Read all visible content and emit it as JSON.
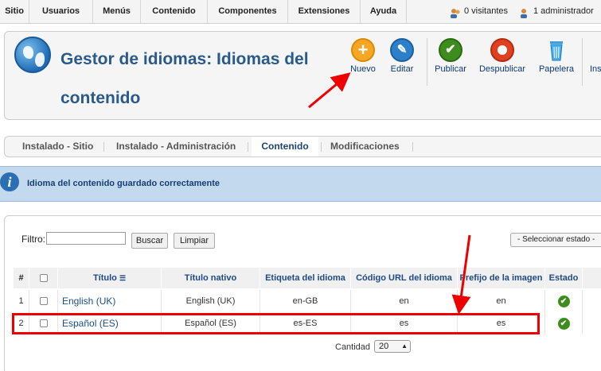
{
  "menu": {
    "items": [
      "Sitio",
      "Usuarios",
      "Menús",
      "Contenido",
      "Componentes",
      "Extensiones",
      "Ayuda"
    ],
    "visitors": "0 visitantes",
    "admins": "1 administrador"
  },
  "header": {
    "title_line1": "Gestor de idiomas: Idiomas del",
    "title_line2": "contenido"
  },
  "toolbar": {
    "new": "Nuevo",
    "edit": "Editar",
    "publish": "Publicar",
    "unpublish": "Despublicar",
    "trash": "Papelera",
    "partial": "Ins"
  },
  "tabs": [
    "Instalado - Sitio",
    "Instalado - Administración",
    "Contenido",
    "Modificaciones"
  ],
  "message": "Idioma del contenido guardado correctamente",
  "filter": {
    "label": "Filtro:",
    "value": "",
    "search": "Buscar",
    "clear": "Limpiar",
    "state": "- Seleccionar estado -"
  },
  "table": {
    "headers": [
      "#",
      "",
      "Título",
      "Título nativo",
      "Etiqueta del idioma",
      "Código URL del idioma",
      "Prefijo de la imagen",
      "Estado"
    ],
    "rows": [
      {
        "num": "1",
        "title": "English (UK)",
        "native": "English (UK)",
        "tag": "en-GB",
        "url": "en",
        "prefix": "en"
      },
      {
        "num": "2",
        "title": "Español (ES)",
        "native": "Español (ES)",
        "tag": "es-ES",
        "url": "es",
        "prefix": "es"
      }
    ]
  },
  "pagination": {
    "label": "Cantidad",
    "value": "20"
  },
  "colors": {
    "brand_blue": "#1c4a84",
    "message_bg": "#c3d9ed",
    "annotation_red": "#e00000"
  }
}
